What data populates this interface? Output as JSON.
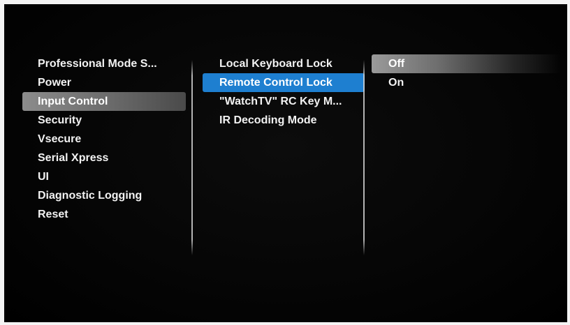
{
  "menu_level_1": {
    "items": [
      "Professional Mode S...",
      "Power",
      "Input Control",
      "Security",
      "Vsecure",
      "Serial Xpress",
      "UI",
      "Diagnostic Logging",
      "Reset"
    ],
    "selected_index": 2
  },
  "menu_level_2": {
    "items": [
      "Local Keyboard Lock",
      "Remote Control Lock",
      "\"WatchTV\" RC Key M...",
      "IR Decoding Mode"
    ],
    "selected_index": 1
  },
  "menu_level_3": {
    "items": [
      "Off",
      "On"
    ],
    "selected_index": 0
  },
  "colors": {
    "background": "#000000",
    "highlight_active": "#1e7fd0",
    "highlight_parent": "#7a7a7a",
    "text": "#f2f2f2"
  }
}
